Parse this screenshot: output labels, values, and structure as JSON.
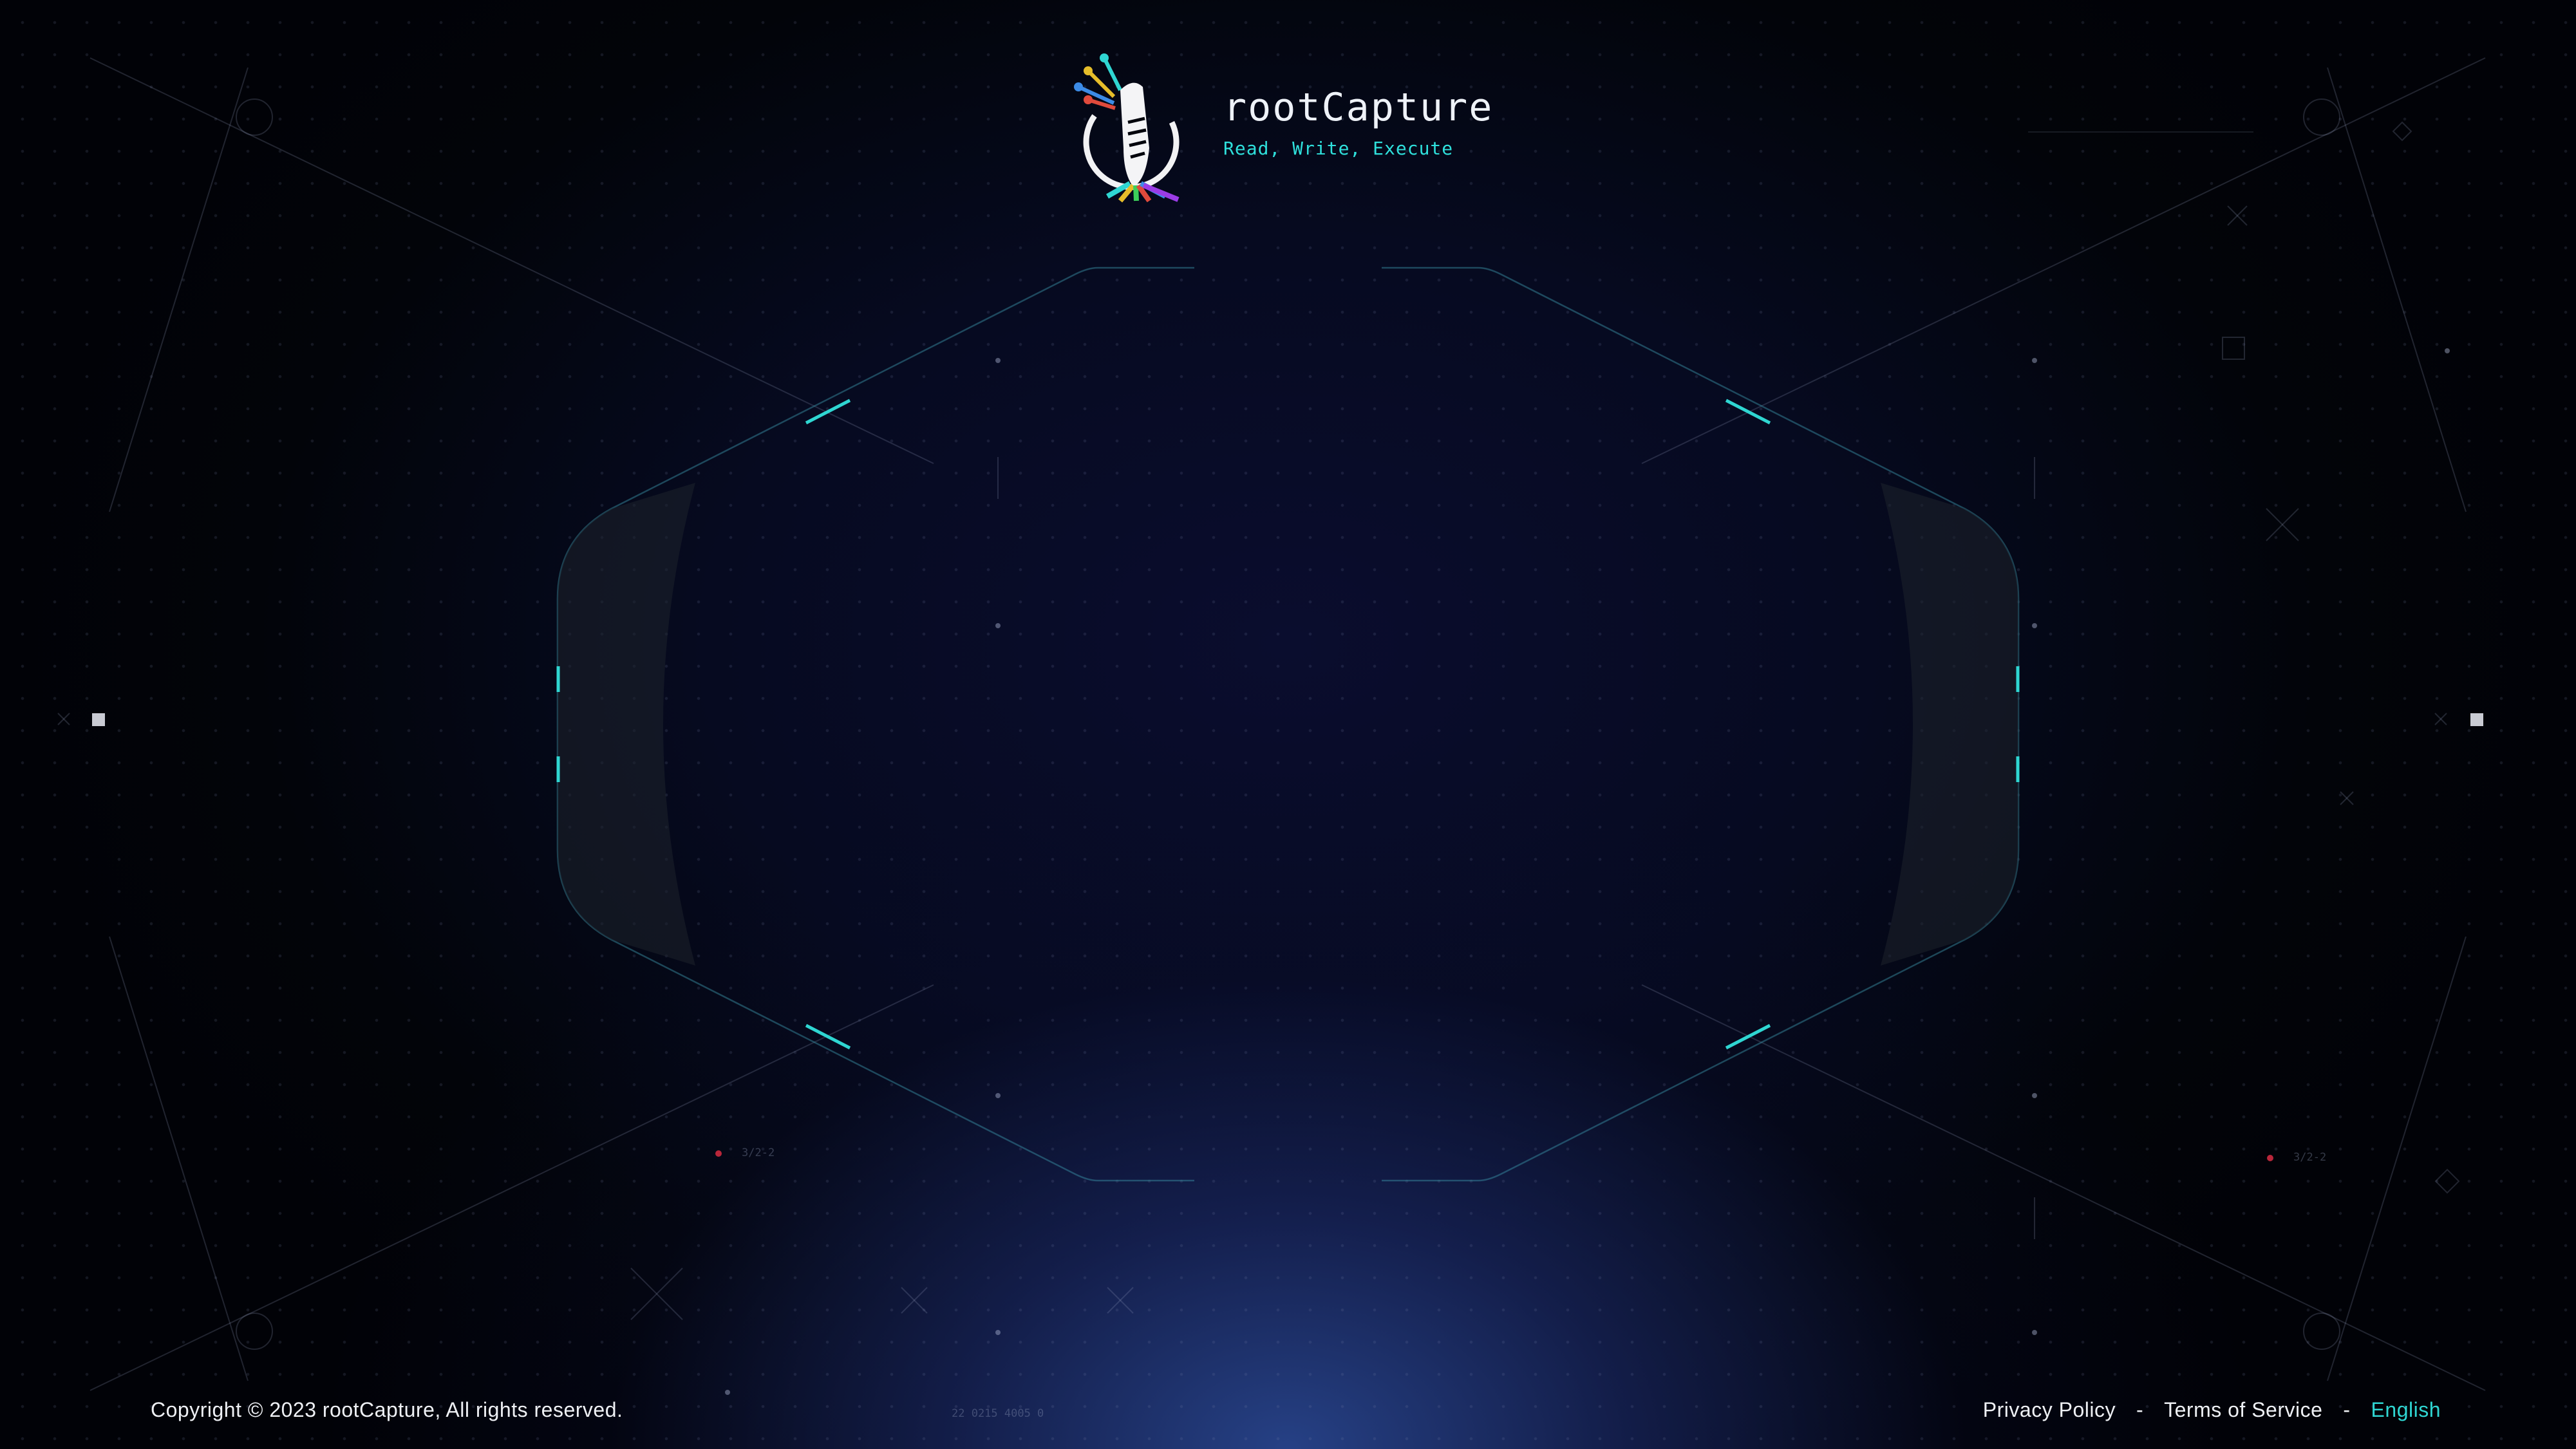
{
  "brand": {
    "name": "rootCapture",
    "tagline": "Read, Write, Execute",
    "logo_icon": "rootcapture-logo-icon"
  },
  "hud": {
    "left_marker_label": "3/2-2",
    "right_marker_label": "3/2-2",
    "bottom_readout": "22  0215   4005  0"
  },
  "footer": {
    "copyright": "Copyright © 2023 rootCapture, All rights reserved.",
    "privacy_label": "Privacy Policy",
    "separator": "-",
    "terms_label": "Terms of Service",
    "language_label": "English"
  },
  "colors": {
    "accent": "#2fd6d2",
    "background": "#03051a",
    "text": "#eef0f4"
  }
}
